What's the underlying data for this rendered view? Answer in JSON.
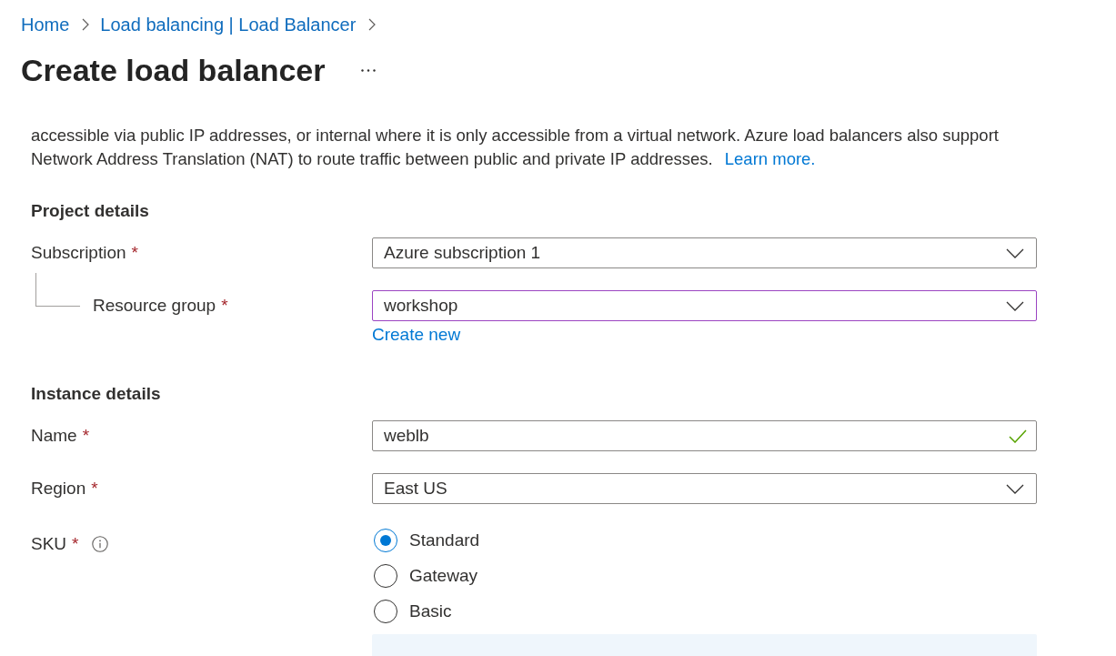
{
  "breadcrumb": [
    {
      "label": "Home"
    },
    {
      "label": "Load balancing | Load Balancer"
    }
  ],
  "page_title": "Create load balancer",
  "description": {
    "text": "accessible via public IP addresses, or internal where it is only accessible from a virtual network. Azure load balancers also support Network Address Translation (NAT) to route traffic between public and private IP addresses.",
    "link": "Learn more."
  },
  "sections": [
    {
      "heading": "Project details",
      "fields": [
        {
          "kind": "dropdown",
          "label": "Subscription",
          "required_mark": "*",
          "value": "Azure subscription 1",
          "focused": false,
          "children": [
            {
              "kind": "dropdown",
              "label": "Resource group",
              "required_mark": "*",
              "value": "workshop",
              "focused": true,
              "link": "Create new"
            }
          ]
        }
      ]
    },
    {
      "heading": "Instance details",
      "fields": [
        {
          "kind": "text",
          "label": "Name",
          "required_mark": "*",
          "value": "weblb",
          "focused": false,
          "valid": true
        },
        {
          "kind": "dropdown",
          "label": "Region",
          "required_mark": "*",
          "value": "East US",
          "focused": false
        },
        {
          "kind": "radio",
          "label": "SKU",
          "required_mark": "*",
          "info": true,
          "options": [
            {
              "label": "Standard",
              "selected": true
            },
            {
              "label": "Gateway",
              "selected": false
            },
            {
              "label": "Basic",
              "selected": false
            }
          ]
        }
      ]
    }
  ]
}
